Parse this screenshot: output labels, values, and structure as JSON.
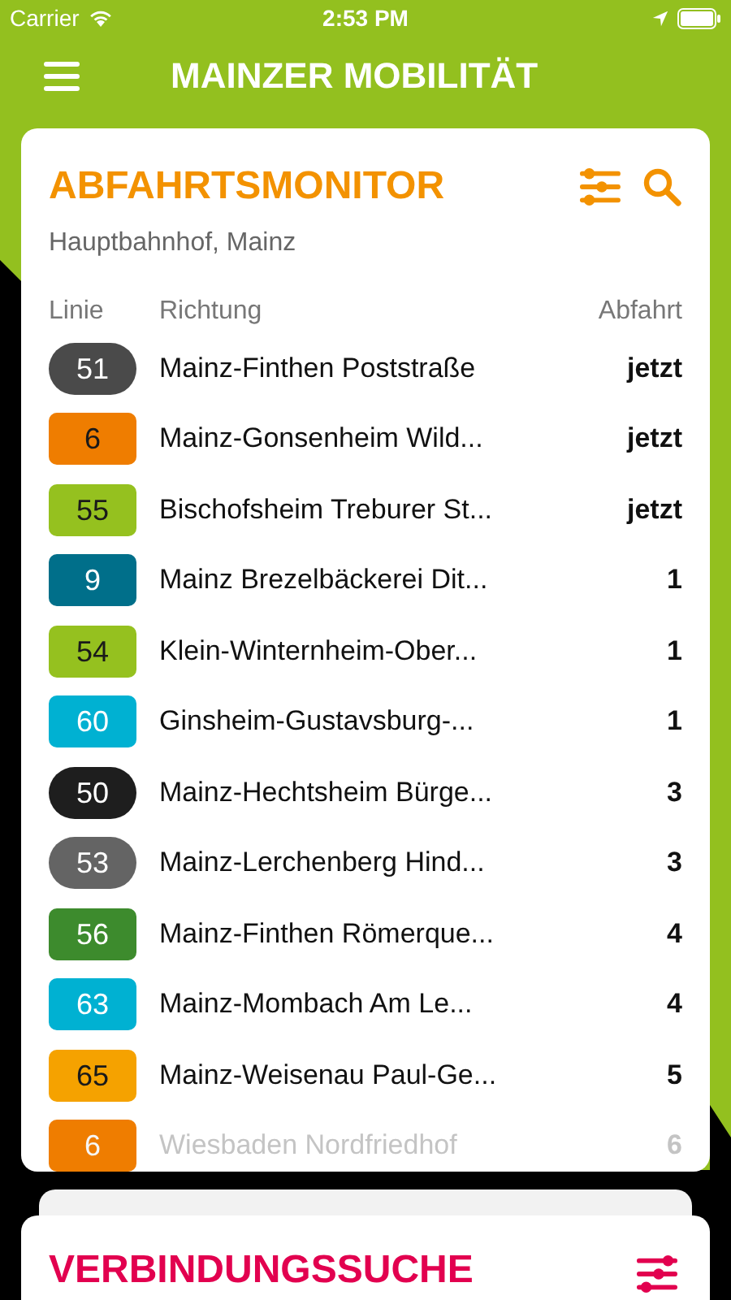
{
  "status_bar": {
    "carrier": "Carrier",
    "time": "2:53 PM"
  },
  "app_bar": {
    "title": "MAINZER MOBILITÄT"
  },
  "departures": {
    "title": "ABFAHRTSMONITOR",
    "stop": "Hauptbahnhof, Mainz",
    "columns": [
      "Linie",
      "Richtung",
      "Abfahrt"
    ],
    "rows": [
      {
        "line": "51",
        "kind": "pill",
        "color": "#4a4a4a",
        "direction": "Mainz-Finthen Poststraße",
        "departure": "jetzt",
        "faded": false
      },
      {
        "line": "6",
        "kind": "box",
        "color": "#ef7d00",
        "direction": "Mainz-Gonsenheim Wild...",
        "departure": "jetzt",
        "faded": false
      },
      {
        "line": "55",
        "kind": "box",
        "color": "#95c11f",
        "direction": "Bischofsheim Treburer St...",
        "departure": "jetzt",
        "faded": false
      },
      {
        "line": "9",
        "kind": "box",
        "color": "#006f8a",
        "direction": "Mainz Brezelbäckerei Dit...",
        "departure": "1",
        "faded": false
      },
      {
        "line": "54",
        "kind": "box",
        "color": "#95c11f",
        "direction": "Klein-Winternheim-Ober...",
        "departure": "1",
        "faded": false
      },
      {
        "line": "60",
        "kind": "box",
        "color": "#00b1d2",
        "direction": "Ginsheim-Gustavsburg-...",
        "departure": "1",
        "faded": false
      },
      {
        "line": "50",
        "kind": "pill",
        "color": "#1e1e1e",
        "direction": "Mainz-Hechtsheim Bürge...",
        "departure": "3",
        "faded": false
      },
      {
        "line": "53",
        "kind": "pill",
        "color": "#646464",
        "direction": "Mainz-Lerchenberg Hind...",
        "departure": "3",
        "faded": false
      },
      {
        "line": "56",
        "kind": "box",
        "color": "#3d8b2d",
        "direction": "Mainz-Finthen Römerque...",
        "departure": "4",
        "faded": false
      },
      {
        "line": "63",
        "kind": "box",
        "color": "#00b1d2",
        "direction": "Mainz-Mombach Am Le...",
        "departure": "4",
        "faded": false
      },
      {
        "line": "65",
        "kind": "box",
        "color": "#f5a200",
        "direction": "Mainz-Weisenau Paul-Ge...",
        "departure": "5",
        "faded": false
      },
      {
        "line": "6",
        "kind": "box",
        "color": "#ef7d00",
        "direction": "Wiesbaden Nordfriedhof",
        "departure": "6",
        "faded": true
      }
    ]
  },
  "connection_search": {
    "title": "VERBINDUNGSSUCHE"
  }
}
